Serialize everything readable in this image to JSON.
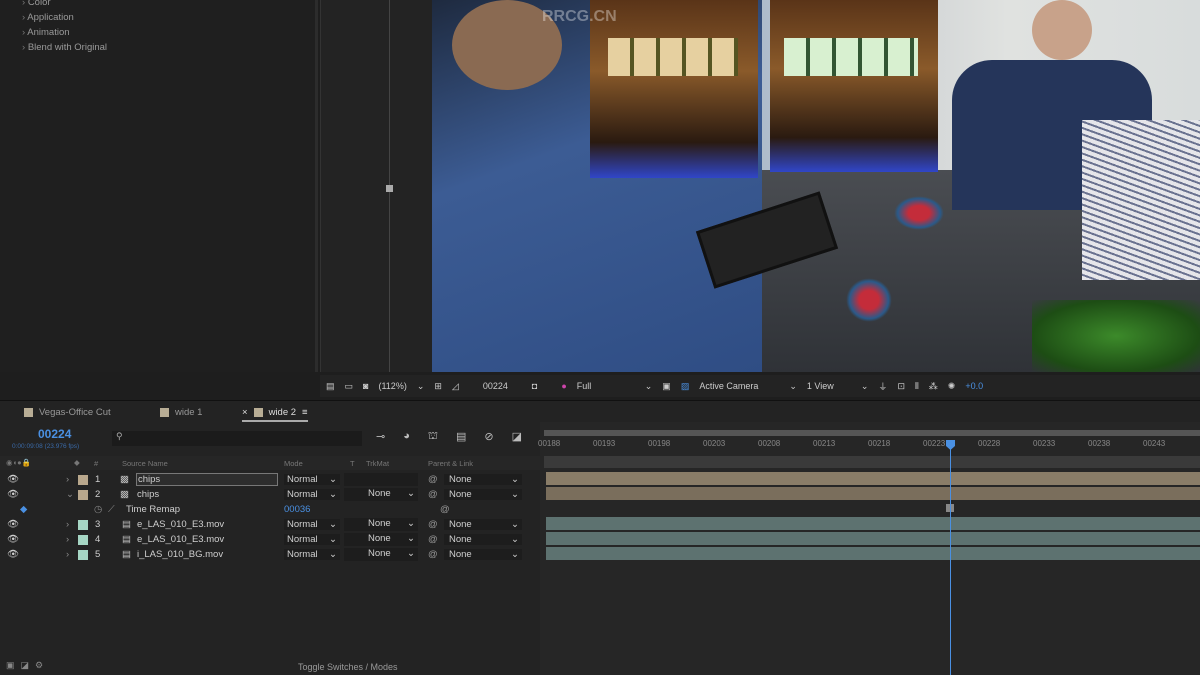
{
  "effects": {
    "items": [
      "Color",
      "Application",
      "Animation",
      "Blend with Original"
    ]
  },
  "viewer": {
    "watermark": "RRCG.CN",
    "zoom": "(112%)",
    "timecode": "00224",
    "resolution": "Full",
    "camera": "Active Camera",
    "views": "1 View",
    "exposure": "+0.0"
  },
  "tabs": [
    {
      "label": "Vegas-Office Cut"
    },
    {
      "label": "wide 1"
    },
    {
      "label": "wide 2",
      "active": true
    }
  ],
  "timeline": {
    "current_time": "00224",
    "fps": "0:00:09:08 (23.976 fps)",
    "search_placeholder": "",
    "columns": {
      "number": "#",
      "source_name": "Source Name",
      "mode": "Mode",
      "t": "T",
      "trkmat": "TrkMat",
      "parent": "Parent & Link"
    },
    "layers": [
      {
        "num": "1",
        "name": "chips",
        "mode": "Normal",
        "trkmat": "",
        "parent": "None",
        "color": "#b8a78c"
      },
      {
        "num": "2",
        "name": "chips",
        "mode": "Normal",
        "trkmat": "None",
        "parent": "None",
        "color": "#b8a78c"
      },
      {
        "num": "3",
        "name": "e_LAS_010_E3.mov",
        "mode": "Normal",
        "trkmat": "None",
        "parent": "None",
        "color": "#a6d6c4"
      },
      {
        "num": "4",
        "name": "e_LAS_010_E3.mov",
        "mode": "Normal",
        "trkmat": "None",
        "parent": "None",
        "color": "#a6d6c4"
      },
      {
        "num": "5",
        "name": "i_LAS_010_BG.mov",
        "mode": "Normal",
        "trkmat": "None",
        "parent": "None",
        "color": "#a6d6c4"
      }
    ],
    "time_remap": {
      "label": "Time Remap",
      "value": "00036"
    },
    "ruler_ticks": [
      "00188",
      "00193",
      "00198",
      "00203",
      "00208",
      "00213",
      "00218",
      "00223",
      "00228",
      "00233",
      "00238",
      "00243"
    ],
    "playhead_frame": 224,
    "toggle_label": "Toggle Switches / Modes",
    "accent": "#4a90e2"
  }
}
